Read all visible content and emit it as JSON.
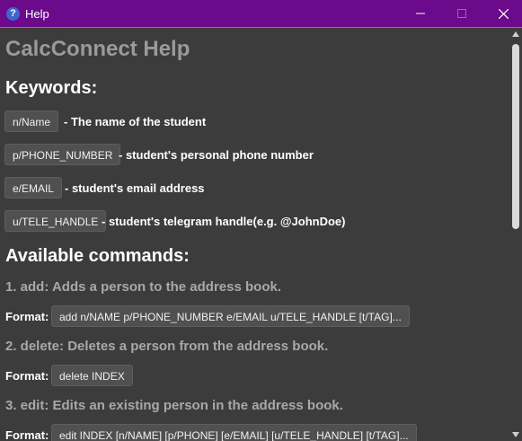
{
  "window": {
    "title": "Help",
    "icon": "help-question-icon",
    "titlebar_color": "#6b0a8a"
  },
  "heading": "CalcConnect Help",
  "keywords": {
    "title": "Keywords:",
    "items": [
      {
        "key": "n/Name",
        "description": "- The name of the student"
      },
      {
        "key": "p/PHONE_NUMBER",
        "description": "- student's personal phone number"
      },
      {
        "key": "e/EMAIL",
        "description": "- student's email address"
      },
      {
        "key": "u/TELE_HANDLE",
        "description": "- student's telegram handle(e.g. @JohnDoe)"
      }
    ]
  },
  "commands": {
    "title": "Available commands:",
    "format_label": "Format:",
    "items": [
      {
        "title": "1. add: Adds a person to the address book.",
        "format": "add n/NAME p/PHONE_NUMBER e/EMAIL u/TELE_HANDLE [t/TAG]..."
      },
      {
        "title": "2. delete: Deletes a person from the address book.",
        "format": "delete INDEX"
      },
      {
        "title": "3. edit: Edits an existing person in the address book.",
        "format": "edit INDEX [n/NAME] [p/PHONE] [e/EMAIL] [u/TELE_HANDLE] [t/TAG]..."
      }
    ]
  }
}
